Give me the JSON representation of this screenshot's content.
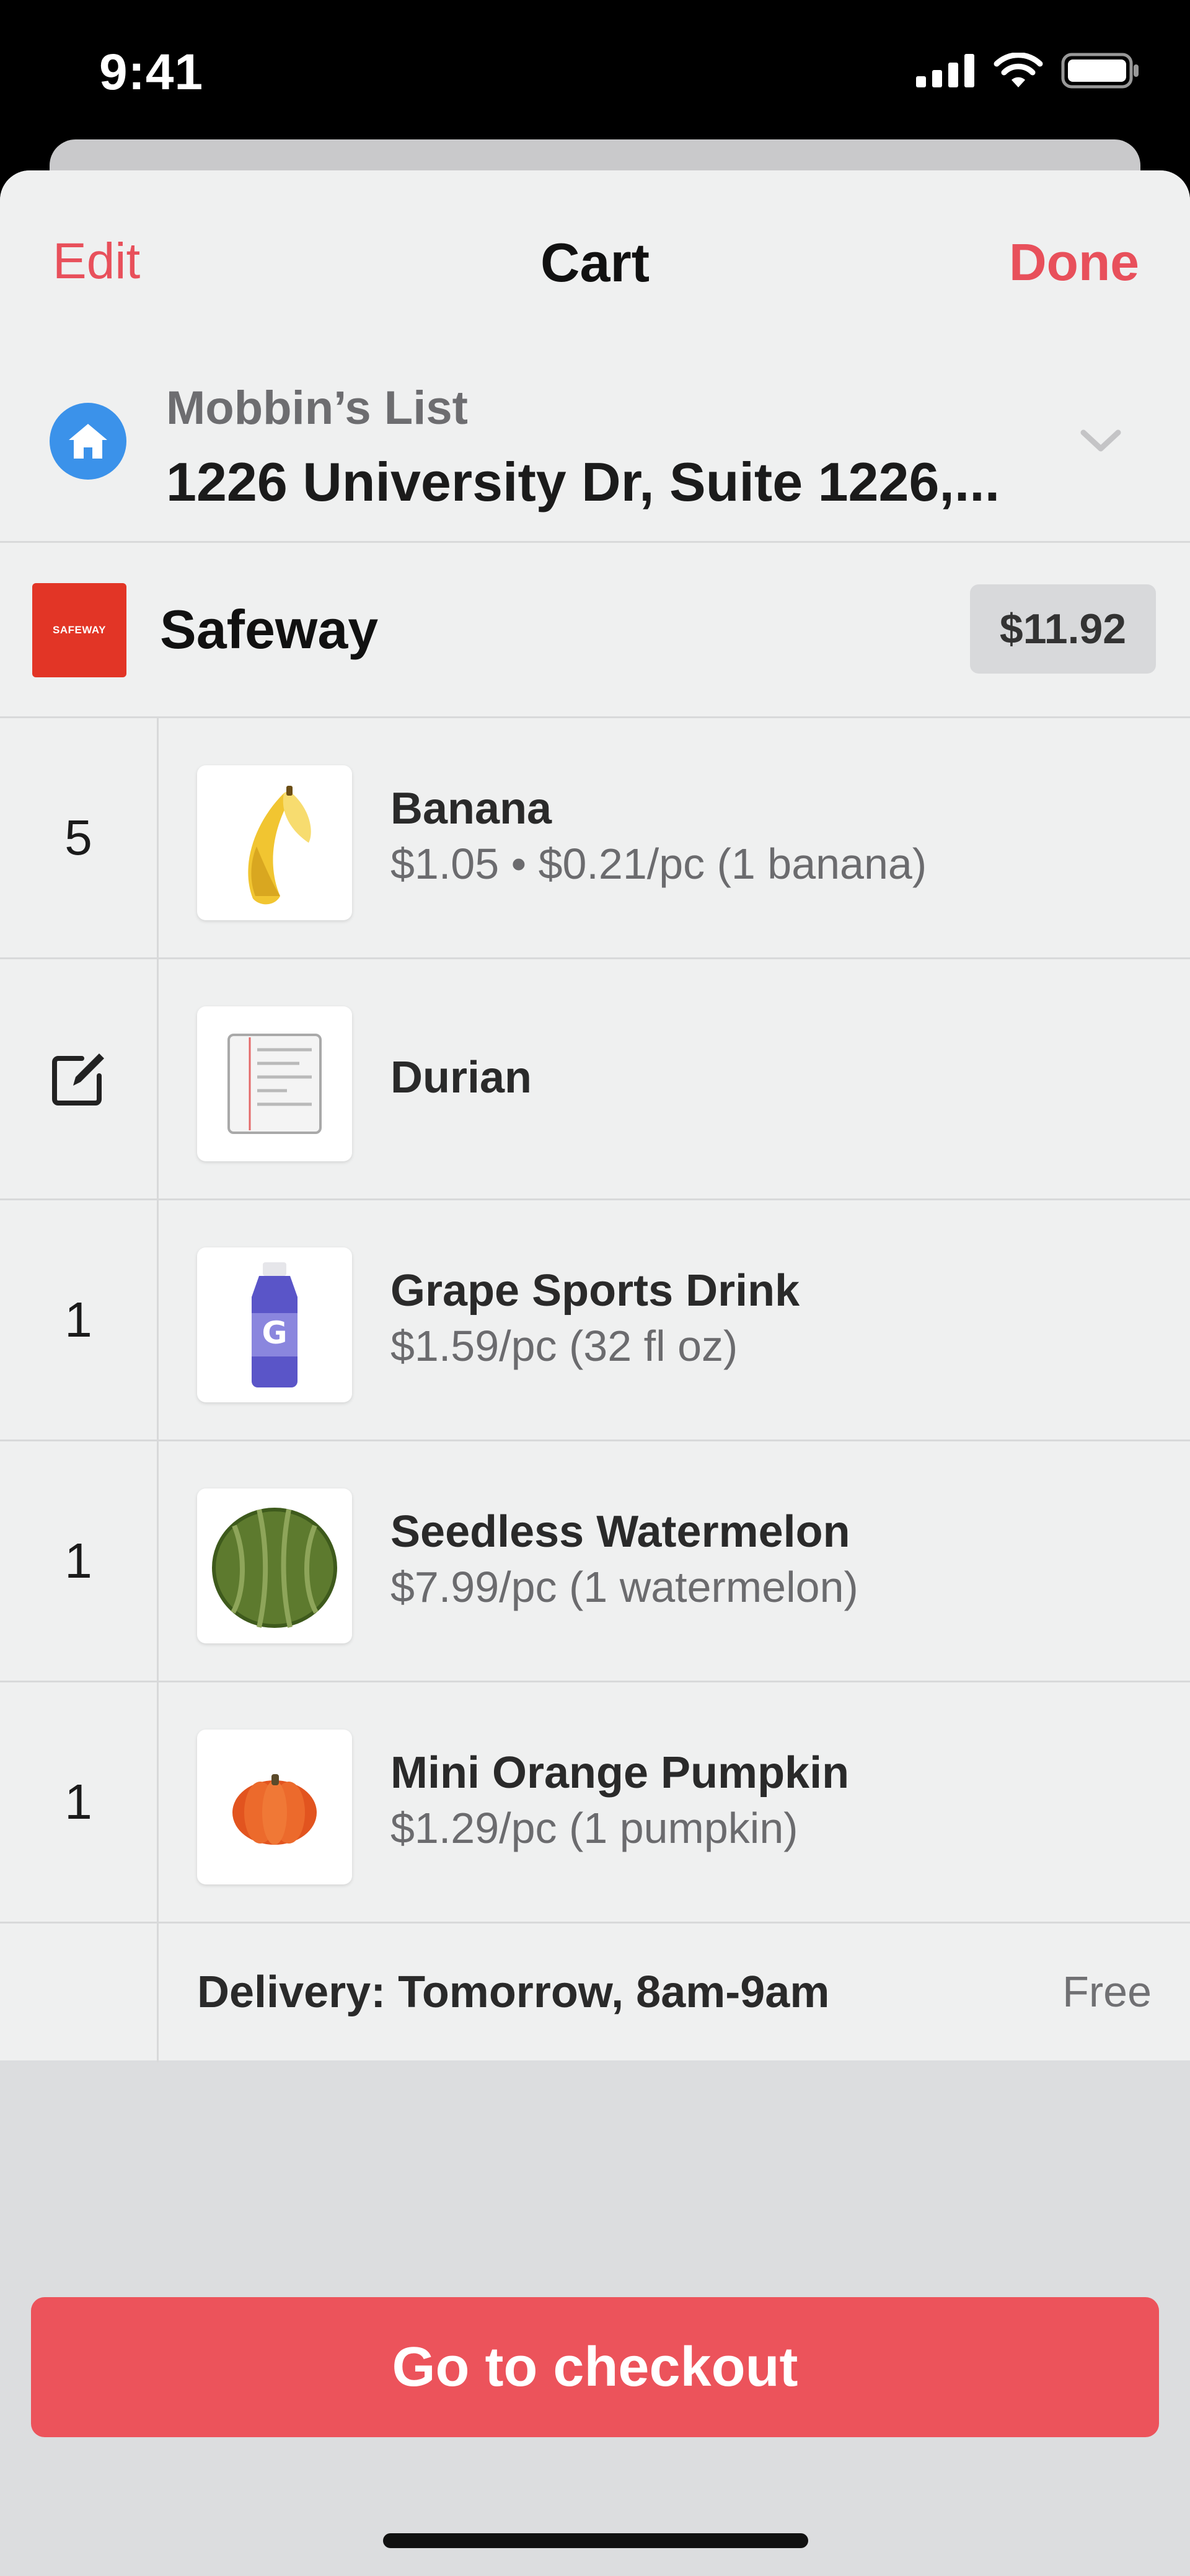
{
  "status_bar": {
    "time": "9:41",
    "icons": [
      "signal-icon",
      "wifi-icon",
      "battery-icon"
    ]
  },
  "nav": {
    "edit_label": "Edit",
    "title": "Cart",
    "done_label": "Done"
  },
  "list": {
    "name": "Mobbin’s List",
    "address": "1226 University Dr, Suite 1226,...",
    "icon": "home-icon"
  },
  "store": {
    "logo_text": "SAFEWAY",
    "name": "Safeway",
    "total": "$11.92"
  },
  "items": [
    {
      "qty": "5",
      "name": "Banana",
      "price": "$1.05 • $0.21/pc (1 banana)",
      "image": "banana"
    },
    {
      "qty": "",
      "name": "Durian",
      "price": "",
      "image": "notepad",
      "qty_icon": "edit-icon"
    },
    {
      "qty": "1",
      "name": "Grape Sports Drink",
      "price": "$1.59/pc (32 fl oz)",
      "image": "sports-drink"
    },
    {
      "qty": "1",
      "name": "Seedless Watermelon",
      "price": "$7.99/pc (1 watermelon)",
      "image": "watermelon"
    },
    {
      "qty": "1",
      "name": "Mini Orange Pumpkin",
      "price": "$1.29/pc (1 pumpkin)",
      "image": "pumpkin"
    }
  ],
  "delivery": {
    "label": "Delivery: Tomorrow, 8am-9am",
    "fee": "Free"
  },
  "checkout": {
    "label": "Go to checkout"
  },
  "colors": {
    "accent": "#e8505b",
    "checkout": "#ec535b",
    "home_badge": "#3b92ea",
    "store_logo": "#e23526"
  }
}
